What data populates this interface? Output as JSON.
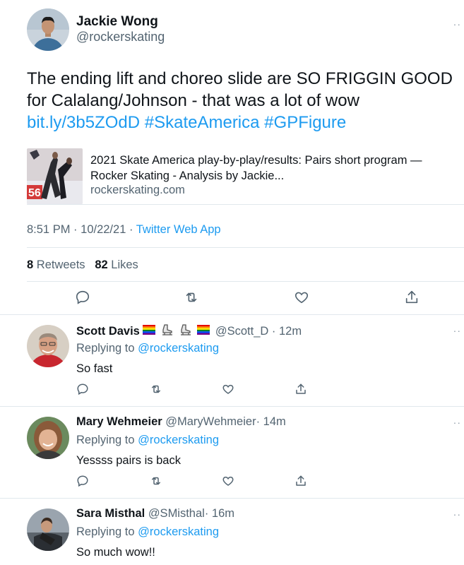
{
  "main_tweet": {
    "name": "Jackie Wong",
    "handle": "@rockerskating",
    "text": "The ending lift and choreo slide are SO FRIGGIN GOOD for Calalang/Johnson - that was a lot of wow",
    "link": "bit.ly/3b5ZOdD",
    "hashtags": [
      "#SkateAmerica",
      "#GPFigure"
    ],
    "card": {
      "title": "2021 Skate America play-by-play/results: Pairs short program — Rocker Skating - Analysis by Jackie...",
      "domain": "rockerskating.com"
    },
    "time": "8:51 PM",
    "date": "10/22/21",
    "dot1": "·",
    "dot2": "·",
    "source": "Twitter Web App",
    "retweets_count": "8",
    "retweets_label": "Retweets",
    "likes_count": "82",
    "likes_label": "Likes",
    "more": "··"
  },
  "replies": [
    {
      "name": "Scott Davis",
      "handle": "@Scott_D",
      "time": "· 12m",
      "replying_label": "Replying to",
      "replying_to": "@rockerskating",
      "text": "So fast",
      "more": "··",
      "emoji": [
        "rainbow-flag",
        "ice-skate",
        "ice-skate",
        "rainbow-flag"
      ]
    },
    {
      "name": "Mary Wehmeier",
      "handle": "@MaryWehmeier",
      "time": "· 14m",
      "replying_label": "Replying to",
      "replying_to": "@rockerskating",
      "text": "Yessss pairs is back",
      "more": "··"
    },
    {
      "name": "Sara Misthal",
      "handle": "@SMisthal",
      "time": "· 16m",
      "replying_label": "Replying to",
      "replying_to": "@rockerskating",
      "text": "So much wow!!",
      "more": "··"
    }
  ],
  "colors": {
    "link": "#1d9bf0",
    "muted": "#536471",
    "text": "#0f1419",
    "divider": "#e1e8ed"
  },
  "icons": {
    "reply": "reply-icon",
    "retweet": "retweet-icon",
    "like": "heart-icon",
    "share": "share-icon"
  }
}
